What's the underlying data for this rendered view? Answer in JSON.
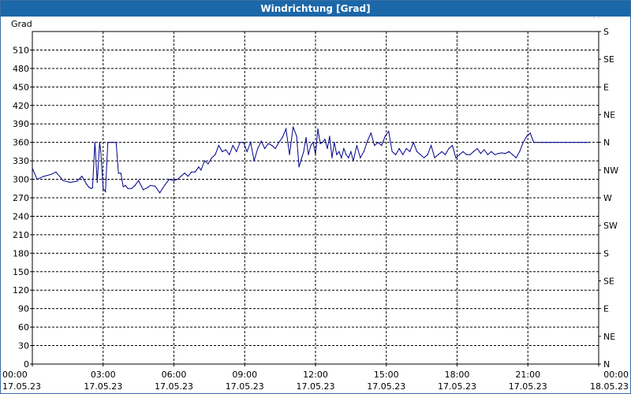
{
  "window": {
    "title": "Windrichtung [Grad]"
  },
  "chart_data": {
    "type": "line",
    "title": "Windrichtung [Grad]",
    "ylabel": "Grad",
    "xlabel": "",
    "ylim": [
      0,
      540
    ],
    "xlim_hours": [
      0,
      24
    ],
    "grid": true,
    "series_color": "#00008b",
    "y_ticks": [
      0,
      30,
      60,
      90,
      120,
      150,
      180,
      210,
      240,
      270,
      300,
      330,
      360,
      390,
      420,
      450,
      480,
      510
    ],
    "right_labels": [
      "N",
      "NE",
      "E",
      "SE",
      "S",
      "SW",
      "W",
      "NW",
      "N",
      "NE",
      "E",
      "SE",
      "S"
    ],
    "x_ticks": [
      {
        "time": "00:00",
        "date": "17.05.23"
      },
      {
        "time": "03:00",
        "date": "17.05.23"
      },
      {
        "time": "06:00",
        "date": "17.05.23"
      },
      {
        "time": "09:00",
        "date": "17.05.23"
      },
      {
        "time": "12:00",
        "date": "17.05.23"
      },
      {
        "time": "15:00",
        "date": "17.05.23"
      },
      {
        "time": "18:00",
        "date": "17.05.23"
      },
      {
        "time": "21:00",
        "date": "17.05.23"
      },
      {
        "time": "00:00",
        "date": "18.05.23"
      }
    ],
    "series": [
      {
        "x_hours": [
          0,
          0.2,
          0.5,
          0.8,
          1.0,
          1.3,
          1.6,
          1.9,
          2.1,
          2.3,
          2.4,
          2.5,
          2.55,
          2.65,
          2.75,
          2.85,
          2.9,
          3.0,
          3.1,
          3.2,
          3.35,
          3.45,
          3.55,
          3.65,
          3.75,
          3.85,
          3.95,
          4.05,
          4.2,
          4.35,
          4.5,
          4.7,
          4.9,
          5.0,
          5.2,
          5.4,
          5.6,
          5.8,
          6.0,
          6.15,
          6.3,
          6.45,
          6.6,
          6.75,
          6.9,
          7.05,
          7.15,
          7.3,
          7.45,
          7.6,
          7.75,
          7.9,
          8.05,
          8.2,
          8.35,
          8.5,
          8.65,
          8.8,
          8.95,
          9.1,
          9.25,
          9.4,
          9.55,
          9.7,
          9.85,
          10.0,
          10.15,
          10.3,
          10.45,
          10.6,
          10.75,
          10.9,
          11.05,
          11.2,
          11.3,
          11.4,
          11.5,
          11.6,
          11.7,
          11.8,
          11.9,
          12.0,
          12.1,
          12.2,
          12.3,
          12.4,
          12.5,
          12.6,
          12.7,
          12.8,
          12.9,
          13.0,
          13.1,
          13.2,
          13.3,
          13.4,
          13.5,
          13.6,
          13.75,
          13.9,
          14.05,
          14.2,
          14.35,
          14.5,
          14.65,
          14.8,
          14.95,
          15.1,
          15.25,
          15.4,
          15.55,
          15.7,
          15.85,
          16.0,
          16.15,
          16.3,
          16.45,
          16.6,
          16.75,
          16.9,
          17.05,
          17.2,
          17.35,
          17.5,
          17.65,
          17.8,
          17.95,
          18.1,
          18.25,
          18.4,
          18.55,
          18.7,
          18.85,
          19.0,
          19.15,
          19.3,
          19.45,
          19.6,
          19.75,
          19.9,
          20.05,
          20.2,
          20.35,
          20.5,
          20.65,
          20.8,
          20.95,
          21.1,
          21.25,
          21.4,
          21.55,
          21.7,
          21.85,
          22.0,
          22.2,
          22.4,
          22.6,
          22.8,
          23.0,
          23.2,
          23.4,
          23.6,
          23.8,
          24.0
        ],
        "values": [
          318,
          300,
          305,
          308,
          312,
          298,
          295,
          297,
          305,
          292,
          287,
          285,
          286,
          360,
          295,
          360,
          345,
          285,
          280,
          360,
          360,
          360,
          360,
          310,
          310,
          288,
          290,
          285,
          285,
          290,
          298,
          283,
          287,
          290,
          289,
          278,
          290,
          300,
          298,
          300,
          305,
          310,
          305,
          312,
          312,
          320,
          315,
          330,
          325,
          335,
          340,
          355,
          345,
          348,
          340,
          355,
          345,
          360,
          360,
          345,
          360,
          330,
          350,
          362,
          350,
          358,
          355,
          350,
          360,
          368,
          382,
          340,
          385,
          370,
          320,
          333,
          345,
          368,
          340,
          355,
          360,
          340,
          382,
          358,
          360,
          365,
          350,
          370,
          335,
          360,
          340,
          345,
          335,
          350,
          340,
          335,
          345,
          330,
          355,
          335,
          345,
          362,
          375,
          355,
          360,
          355,
          370,
          378,
          345,
          340,
          350,
          340,
          350,
          345,
          360,
          345,
          340,
          335,
          340,
          355,
          335,
          340,
          345,
          340,
          350,
          355,
          335,
          340,
          345,
          340,
          340,
          345,
          350,
          342,
          348,
          340,
          345,
          340,
          342,
          343,
          342,
          345,
          340,
          335,
          345,
          360,
          370,
          375,
          360,
          360,
          360,
          360,
          360,
          360,
          360,
          360,
          360,
          360,
          360,
          360,
          360,
          360
        ]
      }
    ]
  }
}
